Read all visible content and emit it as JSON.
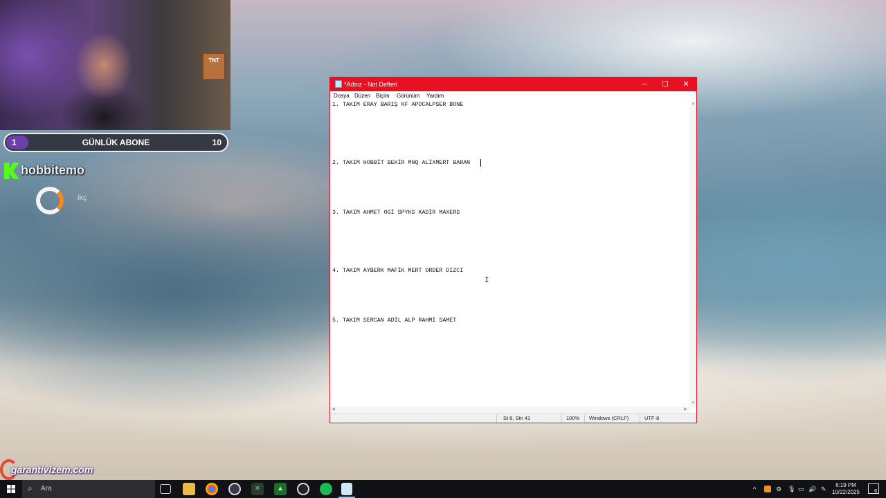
{
  "overlay": {
    "sub_goal": {
      "current": "1",
      "title": "GÜNLÜK ABONE",
      "target": "10"
    },
    "channel_name": "hobbitemo",
    "sponsor_text": "ikç",
    "sponsor_brand": "garantivizem.com",
    "webcam_prop_text": "TNT"
  },
  "window": {
    "title": "*Adsız - Not Defteri",
    "controls": {
      "minimize": "─",
      "maximize": "☐",
      "close": "✕"
    },
    "accent_color": "#e81123"
  },
  "menu": [
    "Dosya",
    "Düzen",
    "Biçim",
    "Görünüm",
    "Yardım"
  ],
  "editor": {
    "lines": [
      "1. TAKIM ERAY BARIŞ KF APOCALPSER BONE",
      "2. TAKIM HOBBİT BEKİR MNQ ALİXMERT BARAN",
      "3. TAKIM AHMET OGİ SPYKS KADİR MAXERS",
      "4. TAKIM AYBERK MAFİK MERT ORDER DIZCI",
      "5. TAKIM SERCAN ADİL ALP RAHMİ SAMET"
    ]
  },
  "status": {
    "position": "St 8, Stn 41",
    "zoom": "100%",
    "line_ending": "Windows (CRLF)",
    "encoding": "UTF-8"
  },
  "taskbar": {
    "search_placeholder": "Ara",
    "time": "6:19 PM",
    "date": "10/22/2025",
    "notification_count": "6",
    "apps": [
      "task-view",
      "file-explorer",
      "chrome",
      "obs",
      "xbox",
      "android-studio",
      "speed-tool",
      "spotify",
      "notepad"
    ]
  }
}
